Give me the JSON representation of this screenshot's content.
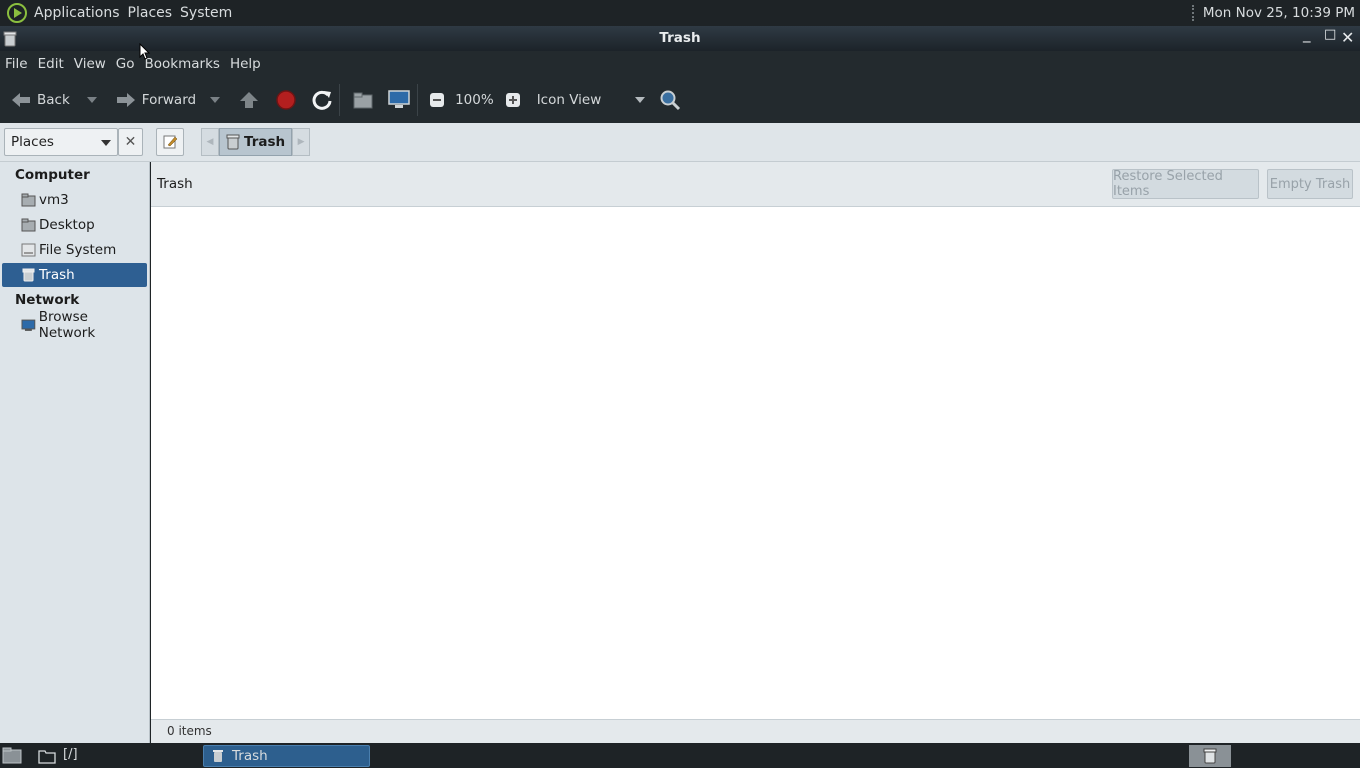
{
  "top_panel": {
    "menu": [
      "Applications",
      "Places",
      "System"
    ],
    "clock": "Mon Nov 25, 10:39 PM"
  },
  "window": {
    "title": "Trash",
    "controls": {
      "minimize": "_",
      "maximize": "□",
      "close": "✕"
    }
  },
  "menubar": [
    "File",
    "Edit",
    "View",
    "Go",
    "Bookmarks",
    "Help"
  ],
  "toolbar": {
    "back_label": "Back",
    "forward_label": "Forward",
    "zoom": "100%",
    "view_mode": "Icon View"
  },
  "location": {
    "places_combo": "Places",
    "breadcrumb": "Trash"
  },
  "sidebar": {
    "computer_header": "Computer",
    "network_header": "Network",
    "items": [
      {
        "label": "vm3",
        "icon": "home-folder-icon"
      },
      {
        "label": "Desktop",
        "icon": "desktop-folder-icon"
      },
      {
        "label": "File System",
        "icon": "drive-icon"
      },
      {
        "label": "Trash",
        "icon": "trash-icon",
        "selected": true
      },
      {
        "label": "Browse Network",
        "icon": "network-icon"
      }
    ]
  },
  "trash_bar": {
    "label": "Trash",
    "restore_label": "Restore Selected Items",
    "empty_label": "Empty Trash"
  },
  "status": "0 items",
  "taskbar": {
    "workspace": "[/]",
    "task_label": "Trash"
  },
  "colors": {
    "panel_bg": "#1e2326",
    "toolbar_bg": "#232a2e",
    "selection": "#2e5f92",
    "sidebar_bg": "#dde4e9"
  }
}
